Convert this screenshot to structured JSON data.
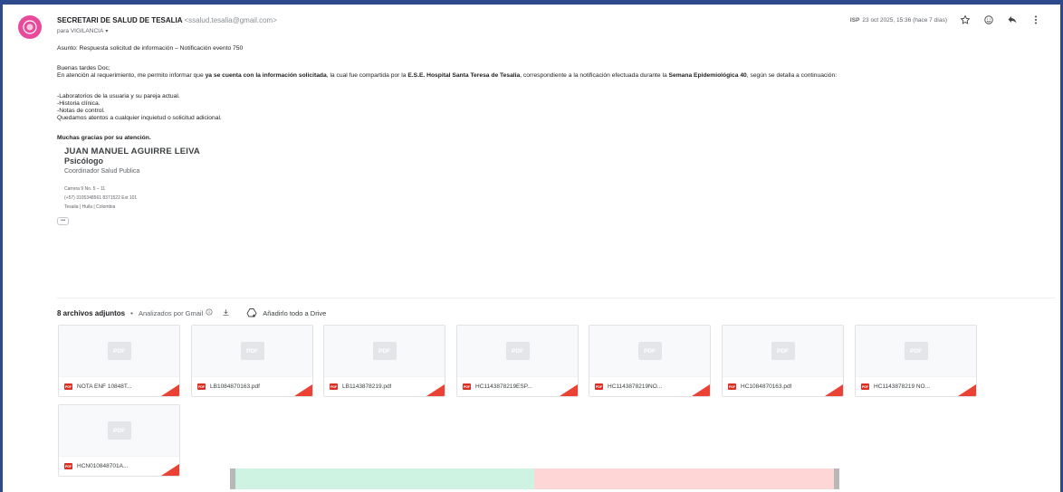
{
  "sender": {
    "name": "SECRETARI DE SALUD DE TESALIA",
    "address": "<ssalud.tesalia@gmail.com>",
    "to_label": "para VIGILANCIA",
    "avatar_color": "#e8499a"
  },
  "meta": {
    "tag": "ISP",
    "date": "23 oct 2025, 15:36 (hace 7 días)",
    "icons": [
      "star-icon",
      "emoji-icon",
      "reply-icon",
      "more-vert-icon"
    ]
  },
  "body": {
    "subject": "Asunto: Respuesta solicitud de información – Notificación evento 750",
    "greeting": "Buenas tardes Doc;",
    "p1_a": "En atención al requerimiento, me permito informar que ",
    "p1_b": "ya se cuenta con la información solicitada",
    "p1_c": ", la cual fue compartida por la ",
    "p1_d": "E.S.E. Hospital Santa Teresa de Tesalia",
    "p1_e": ", correspondiente a la notificación efectuada durante la ",
    "p1_f": "Semana Epidemiológica 40",
    "p1_g": ", según se detalla a continuación:",
    "items": [
      "-Laboratorios de la usuaria y su pareja actual.",
      "-Historia clínica.",
      "-Notas de control."
    ],
    "closing_line": "Quedamos atentos a cualquier inquietud o solicitud adicional.",
    "thanks": "Muchas gracias por su atención."
  },
  "signature": {
    "name": "JUAN MANUEL AGUIRRE LEIVA",
    "role": "Psicólogo",
    "title": "Coordinador Salud Publica",
    "address": "Carrera 9 No. 5 – 11",
    "phone": "(+57) 3105348561  8371522 Ext 101",
    "location": "Tesalia | Huila | Colombia",
    "more": "•••"
  },
  "attachments": {
    "count_label": "8 archivos adjuntos",
    "separator": "•",
    "scan_label": "Analizados por Gmail",
    "drive_label": "Añadirlo todo a Drive",
    "placeholder": "PDF",
    "badge": "PDF",
    "files": [
      "NOTA ENF 10848T...",
      "LB1084870163.pdf",
      "LB1143878219.pdf",
      "HC1143878219ESP...",
      "HC1143878219NO...",
      "HC1084870163.pdf",
      "HC1143878219 NO...",
      "HCN010848701A..."
    ]
  },
  "colors": {
    "frame": "#2c4a8c",
    "pdf_red": "#d93025",
    "strip_green": "#cff3e3",
    "strip_red": "#ffd6d6"
  }
}
